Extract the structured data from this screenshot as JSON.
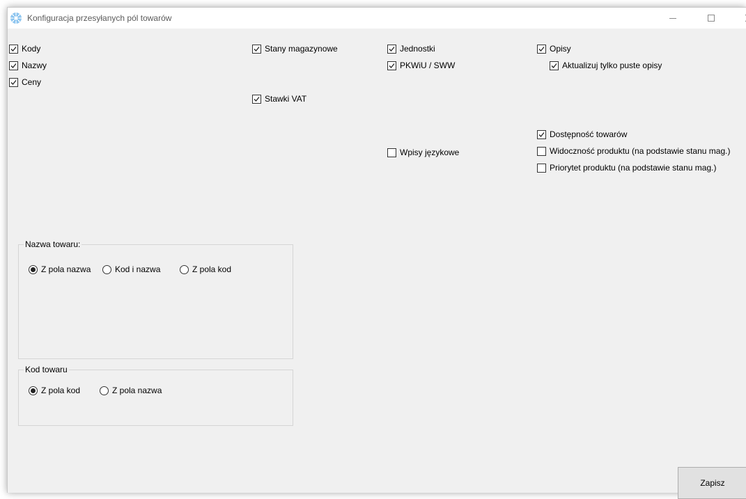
{
  "window": {
    "title": "Konfiguracja przesyłanych pól towarów",
    "accent_color": "#5aa9e6"
  },
  "checkboxes": {
    "kody": {
      "label": "Kody",
      "checked": true
    },
    "nazwy": {
      "label": "Nazwy",
      "checked": true
    },
    "ceny": {
      "label": "Ceny",
      "checked": true
    },
    "stany": {
      "label": "Stany magazynowe",
      "checked": true
    },
    "stawki_vat": {
      "label": "Stawki VAT",
      "checked": true
    },
    "jednostki": {
      "label": "Jednostki",
      "checked": true
    },
    "pkwiu": {
      "label": "PKWiU / SWW",
      "checked": true
    },
    "wpisy_jezykowe": {
      "label": "Wpisy językowe",
      "checked": false
    },
    "opisy": {
      "label": "Opisy",
      "checked": true
    },
    "aktualizuj_puste": {
      "label": "Aktualizuj tylko puste opisy",
      "checked": true
    },
    "dostepnosc": {
      "label": "Dostępność towarów",
      "checked": true
    },
    "widocznosc": {
      "label": "Widoczność produktu (na podstawie stanu mag.)",
      "checked": false
    },
    "priorytet": {
      "label": "Priorytet produktu (na podstawie stanu mag.)",
      "checked": false
    }
  },
  "nazwa_towaru": {
    "title": "Nazwa towaru:",
    "options": [
      "Z pola nazwa",
      "Kod i nazwa",
      "Z pola kod"
    ],
    "selected": "Z pola nazwa"
  },
  "kod_towaru": {
    "title": "Kod towaru",
    "options": [
      "Z pola kod",
      "Z pola nazwa"
    ],
    "selected": "Z pola kod"
  },
  "save_label": "Zapisz"
}
